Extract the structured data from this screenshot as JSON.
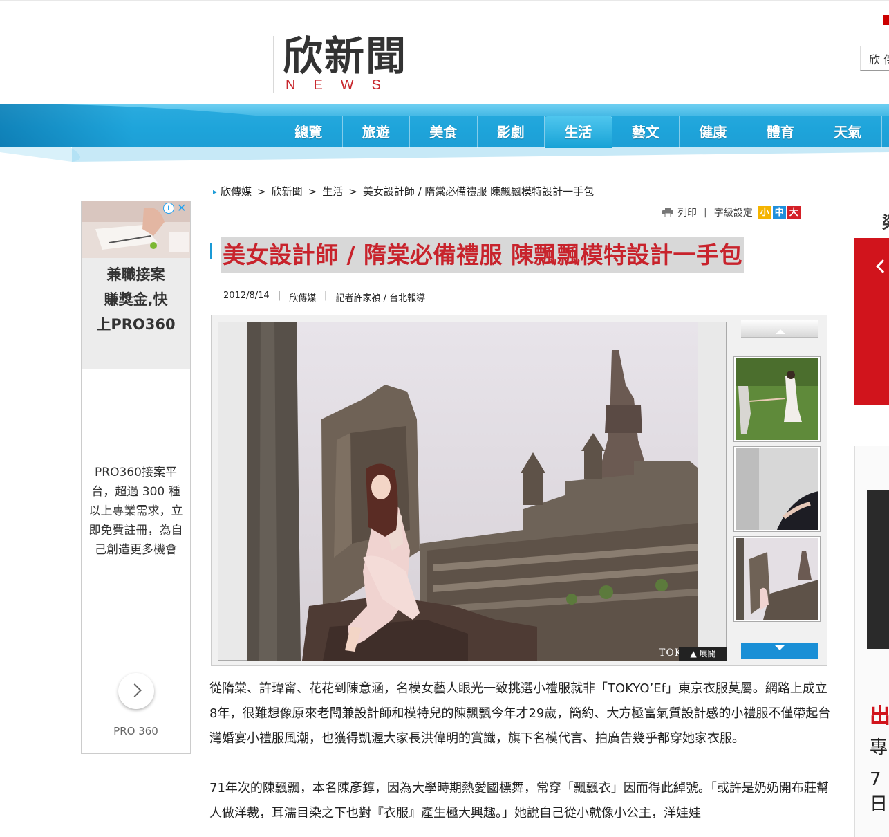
{
  "header": {
    "logo_cn": "欣新聞",
    "logo_en": "NEWS",
    "search_stub": "欣 傳"
  },
  "nav": {
    "items": [
      "總覽",
      "旅遊",
      "美食",
      "影劇",
      "生活",
      "藝文",
      "健康",
      "體育",
      "天氣"
    ],
    "active": "生活"
  },
  "breadcrumb": [
    "欣傳媒",
    "欣新聞",
    "生活",
    "美女設計師 / 隋棠必備禮服 陳飄飄模特設計一手包"
  ],
  "tools": {
    "print_label": "列印",
    "font_setting_label": "字級設定",
    "size_small": "小",
    "size_medium": "中",
    "size_large": "大"
  },
  "article": {
    "title": "美女設計師 / 隋棠必備禮服 陳飄飄模特設計一手包",
    "date": "2012/8/14",
    "source": "欣傳媒",
    "reporter": "記者許家禎 / 台北報導",
    "paragraphs": [
      "從隋棠、許瑋甯、花花到陳意涵，名模女藝人眼光一致挑選小禮服就非「TOKYO’Ef」東京衣服莫屬。網路上成立8年，很難想像原來老闆兼設計師和模特兒的陳飄飄今年才29歲，簡約、大方極富氣質設計感的小禮服不僅帶起台灣婚宴小禮服風潮，也獲得凱渥大家長洪偉明的賞識，旗下名模代言、拍廣告幾乎都穿她家衣服。",
      "71年次的陳飄飄，本名陳彥錞，因為大學時期熱愛國標舞，常穿「飄飄衣」因而得此綽號。「或許是奶奶開布莊幫人做洋裁，耳濡目染之下也對『衣服』產生極大興趣。」她說自己從小就像小公主，洋娃娃"
    ]
  },
  "gallery": {
    "watermark": "TOKYO’",
    "expand_label": "展開",
    "thumbnails": [
      "thumb-girls-field",
      "thumb-model-studio",
      "thumb-temple"
    ]
  },
  "ad": {
    "headline": "兼職接案\n賺獎金,快\n上PRO360",
    "description": "PRO360接案平台，超過 300 種以上專業需求，立即免費註冊，為自己創造更多機會",
    "brand": "PRO 360",
    "info_icon": "i",
    "close_icon": "✕"
  },
  "right_column": {
    "char": "梁",
    "text1": "出",
    "text2": "專",
    "text3": "7日"
  },
  "colors": {
    "brand_red": "#c8232c",
    "nav_blue": "#1a9ad6",
    "ad_red": "#d1141c"
  }
}
